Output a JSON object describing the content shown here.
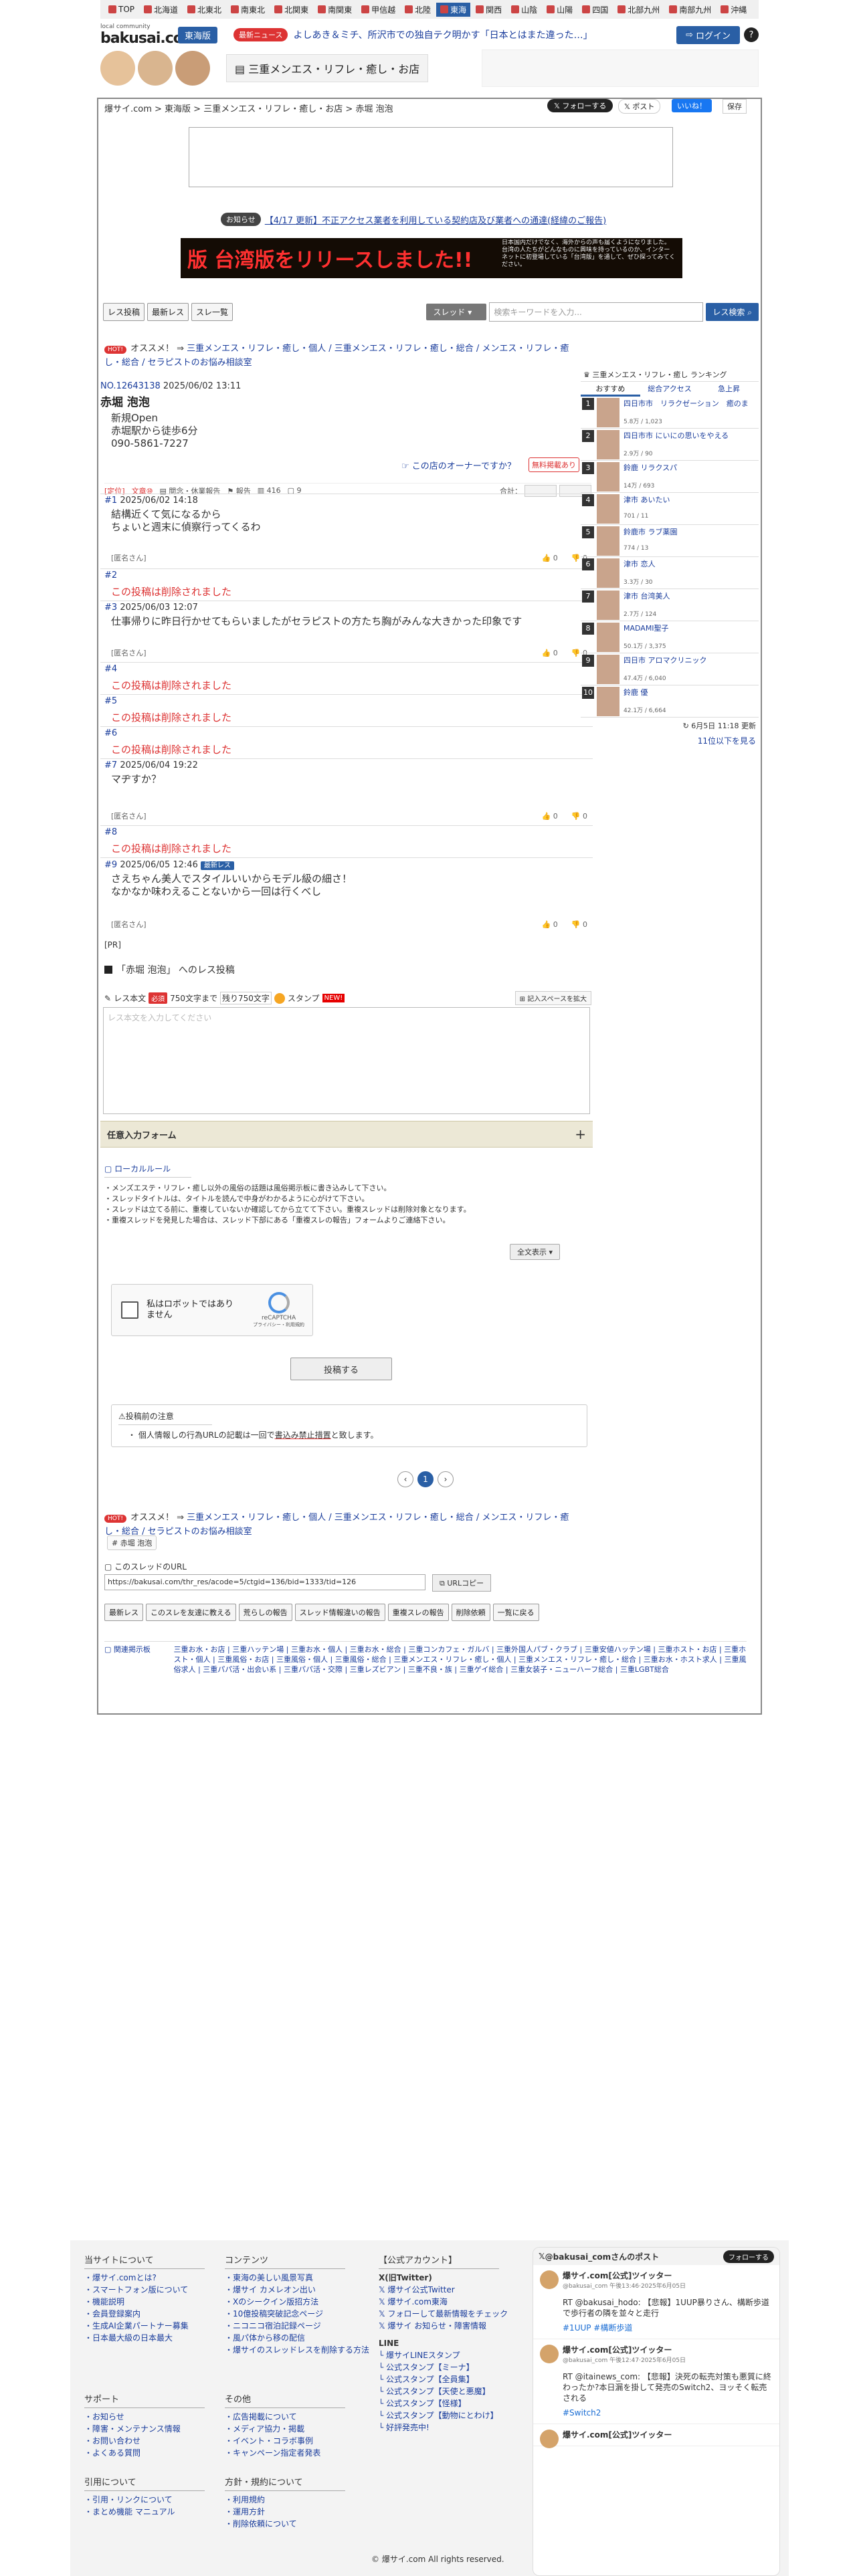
{
  "regions": [
    "TOP",
    "北海道",
    "北東北",
    "南東北",
    "北関東",
    "南関東",
    "甲信越",
    "北陸",
    "東海",
    "関西",
    "山陰",
    "山陽",
    "四国",
    "北部九州",
    "南部九州",
    "沖縄"
  ],
  "header": {
    "logo_small": "local community",
    "logo": "bakusai.com",
    "area": "東海版",
    "news_badge": "最新ニュース",
    "news_text": "よしあき＆ミチ、所沢市での独自テク明かす「日本とはまた違った…」",
    "login": "ログイン",
    "help": "?"
  },
  "category_title": "三重メンエス・リフレ・癒し・お店",
  "breadcrumb": "爆サイ.com > 東海版 > 三重メンエス・リフレ・癒し・お店 > 赤堀 泡泡",
  "social": {
    "follow": "フォローする",
    "post": "ポスト",
    "like": "いいね！",
    "save": "保存"
  },
  "notice": {
    "badge": "お知らせ",
    "text": "【4/17 更新】不正アクセス業者を利用している契約店及び業者への通達(経緯のご報告)"
  },
  "banner": {
    "text": "版 台湾版をリリースしました!!",
    "side": "日本国内だけでなく、海外からの声も届くようになりました。台湾の人たちがどんなものに興味を持っているのか、インターネットに初登場している「台湾版」を通して、ぜひ探ってみてください。"
  },
  "toolbar": {
    "latest": "レス投稿",
    "latest_res": "最新レス",
    "thread_list": "スレ一覧",
    "select": "スレッド",
    "search_placeholder": "検索キーワードを入力...",
    "search_btn": "レス検索"
  },
  "recommend": {
    "hot": "HOT!",
    "label": "オススメ！ ⇒",
    "text": "三重メンエス・リフレ・癒し・個人 / 三重メンエス・リフレ・癒し・総合 / メンエス・リフレ・癒し・総合 / セラピストのお悩み相談室"
  },
  "thread": {
    "no": "NO.12643138",
    "date": "2025/06/02 13:11",
    "title": "赤堀 泡泡",
    "body": [
      "新規Open",
      "赤堀駅から徒歩6分",
      "090-5861-7227"
    ],
    "owner_question": "この店のオーナーですか？",
    "free_badge": "無料掲載あり",
    "tools": [
      "[定位]",
      "文章⑩",
      "閲念・休業報告",
      "報告",
      "416",
      "9"
    ],
    "vote_label": "合計："
  },
  "posts": [
    {
      "no": "#1",
      "date": "2025/06/02 14:18",
      "body": [
        "結構近くて気になるから",
        "ちょいと週末に偵察行ってくるわ"
      ],
      "author": "[匿名さん]",
      "up": "0",
      "down": "0"
    },
    {
      "no": "#2",
      "deleted": "この投稿は削除されました"
    },
    {
      "no": "#3",
      "date": "2025/06/03 12:07",
      "body": [
        "仕事帰りに昨日行かせてもらいましたがセラピストの方たち胸がみんな大きかった印象です"
      ],
      "author": "[匿名さん]",
      "up": "0",
      "down": "0"
    },
    {
      "no": "#4",
      "deleted": "この投稿は削除されました"
    },
    {
      "no": "#5",
      "deleted": "この投稿は削除されました"
    },
    {
      "no": "#6",
      "deleted": "この投稿は削除されました"
    },
    {
      "no": "#7",
      "date": "2025/06/04 19:22",
      "body": [
        "マヂすか？"
      ],
      "author": "[匿名さん]",
      "up": "0",
      "down": "0"
    },
    {
      "no": "#8",
      "deleted": "この投稿は削除されました"
    },
    {
      "no": "#9",
      "date": "2025/06/05 12:46",
      "newbadge": "最新レス",
      "body": [
        "さえちゃん美人でスタイルいいからモデル級の細さ！",
        "なかなか味わえることないから一回は行くべし"
      ],
      "author": "[匿名さん]",
      "up": "0",
      "down": "0"
    }
  ],
  "pr": "[PR]",
  "form": {
    "title": "「赤堀 泡泡」 へのレス投稿",
    "body_label": "レス本文",
    "required": "必須",
    "limit": "750文字まで",
    "remaining": "残り750文字",
    "stamp": "スタンプ",
    "new": "NEW!",
    "expand": "記入スペースを拡大",
    "placeholder": "レス本文を入力してください",
    "optional": "任意入力フォーム",
    "plus": "+",
    "rule_title": "ローカルルール",
    "rules": [
      "・メンズエステ・リフレ・癒し以外の風俗の話題は風俗掲示板に書き込みして下さい。",
      "・スレッドタイトルは、タイトルを読んで中身がわかるように心がけて下さい。",
      "・スレッドは立てる前に、重複していないか確認してから立てて下さい。重複スレッドは削除対象となります。",
      "・重複スレッドを発見した場合は、スレッド下部にある「重複スレの報告」フォームよりご連絡下さい。"
    ],
    "all_text": "全文表示",
    "captcha_text": "私はロボットではありません",
    "captcha_brand": "reCAPTCHA",
    "captcha_sub": "プライバシー・利用規約",
    "submit": "投稿する",
    "caution_title": "投稿前の注意",
    "caution_pre": "・ 個人情報しの行為URLの記載は一回で",
    "caution_u": "書込み禁止措置",
    "caution_post": "と致します。"
  },
  "pager": {
    "prev": "‹",
    "cur": "1",
    "next": "›"
  },
  "thread_tag": "赤堀 泡泡",
  "url": {
    "label": "このスレッドのURL",
    "value": "https://bakusai.com/thr_res/acode=5/ctgid=136/bid=1333/tid=126",
    "copy": "URLコピー"
  },
  "bottom_tools": [
    "最新レス",
    "このスレを友達に教える",
    "荒らしの報告",
    "スレッド情報違いの報告",
    "重複スレの報告",
    "削除依頼",
    "一覧に戻る"
  ],
  "related": {
    "title": "関連掲示板",
    "links": "三重お水・お店 | 三重ハッテン場 | 三重お水・個人 | 三重お水・総合 | 三重コンカフェ・ガルバ | 三重外国人パブ・クラブ | 三重安値ハッテン場 | 三重ホスト・お店 | 三重ホスト・個人 | 三重風俗・お店 | 三重風俗・個人 | 三重風俗・総合 | 三重メンエス・リフレ・癒し・個人 | 三重メンエス・リフレ・癒し・総合 | 三重お水・ホスト求人 | 三重風俗求人 | 三重パパ活・出会い系 | 三重パパ活・交際 | 三重レズビアン | 三重不良・族 | 三重ゲイ総合 | 三重女装子・ニューハーフ総合 | 三重LGBT総合"
  },
  "ranking": {
    "head": "三重メンエス・リフレ・癒し ランキング",
    "tabs": [
      "おすすめ",
      "総合アクセス",
      "急上昇"
    ],
    "items": [
      {
        "n": "1",
        "title": "四日市市　リラクゼーション　癒のま",
        "meta": "5.8万 / 1,023"
      },
      {
        "n": "2",
        "title": "四日市市 にいにの思いをやえる",
        "meta": "2.9万 / 90"
      },
      {
        "n": "3",
        "title": "鈴鹿 リラクスパ",
        "meta": "14万 / 693"
      },
      {
        "n": "4",
        "title": "津市 あいたい",
        "meta": "701 / 11"
      },
      {
        "n": "5",
        "title": "鈴鹿市 ラブ薬園",
        "meta": "774 / 13"
      },
      {
        "n": "6",
        "title": "津市 恋人",
        "meta": "3.3万 / 30"
      },
      {
        "n": "7",
        "title": "津市 台湾美人",
        "meta": "2.7万 / 124"
      },
      {
        "n": "8",
        "title": "MADAMI聖子",
        "meta": "50.1万 / 3,375"
      },
      {
        "n": "9",
        "title": "四日市 アロマクリニック",
        "meta": "47.4万 / 6,040"
      },
      {
        "n": "10",
        "title": "鈴鹿 優",
        "meta": "42.1万 / 6,664"
      }
    ],
    "updated": "6月5日 11:18 更新",
    "more": "11位以下を見る"
  },
  "footer": {
    "site_title": "当サイトについて",
    "site_links": [
      "爆サイ.comとは?",
      "スマートフォン版について",
      "機能説明",
      "会員登録案内",
      "生成AI企業パートナー募集",
      "日本最大級の日本最大"
    ],
    "content_title": "コンテンツ",
    "content_links": [
      "東海の美しい風景写真",
      "爆サイ カメレオン出い",
      "Xのシークイン版招方法",
      "10億投稿突破記念ページ",
      "ニコニコ宿泊記録ページ",
      "風パ体から移の配信",
      "爆サイのスレッドレスを削除する方法"
    ],
    "account_title": "【公式アカウント】",
    "x_title": "X(旧Twitter)",
    "x_links": [
      "爆サイ公式Twitter",
      "爆サイ.com東海",
      "フォローして最新情報をチェック",
      "爆サイ お知らせ・障害情報"
    ],
    "line_title": "LINE",
    "line_links": [
      "爆サイLINEスタンプ",
      "公式スタンプ【ミーナ】",
      "公式スタンプ【全員集】",
      "公式スタンプ【天使と悪魔】",
      "公式スタンプ【怪様】",
      "公式スタンプ【動物にとわけ】",
      "好評発売中!"
    ],
    "support_title": "サポート",
    "support_links": [
      "お知らせ",
      "障害・メンテナンス情報",
      "お問い合わせ",
      "よくある質問"
    ],
    "other_title": "その他",
    "other_links": [
      "広告掲載について",
      "メディア協力・掲載",
      "イベント・コラボ事例",
      "キャンペーン指定者発表"
    ],
    "link_title": "引用について",
    "link_links": [
      "引用・リンクについて",
      "まとめ機能 マニュアル"
    ],
    "policy_title": "方針・規約について",
    "policy_links": [
      "利用規約",
      "運用方針",
      "削除依頼について"
    ],
    "copyright": "© 爆サイ.com All rights reserved."
  },
  "twitter": {
    "head": "@bakusai_comさんのポスト",
    "follow": "フォローする",
    "tweets": [
      {
        "name": "爆サイ.com[公式]ツイッター",
        "meta": "@bakusai_com 午後13:46·2025年6月05日",
        "text": "RT @bakusai_hodo: 【悲報】1UUP暴りさん、構断歩道で歩行者の隣を並々と走行",
        "tags": "#1UUP #構断歩道"
      },
      {
        "name": "爆サイ.com[公式]ツイッター",
        "meta": "@bakusai_com 午後12:47·2025年6月05日",
        "text": "RT @itainews_com: 【悲報】決死の転売対策も悪質に終わったか?本日漏を掛して発売のSwitch2、ヨッそく転売される",
        "tags": "#Switch2"
      },
      {
        "name": "爆サイ.com[公式]ツイッター",
        "meta": "",
        "text": "",
        "tags": ""
      }
    ]
  }
}
